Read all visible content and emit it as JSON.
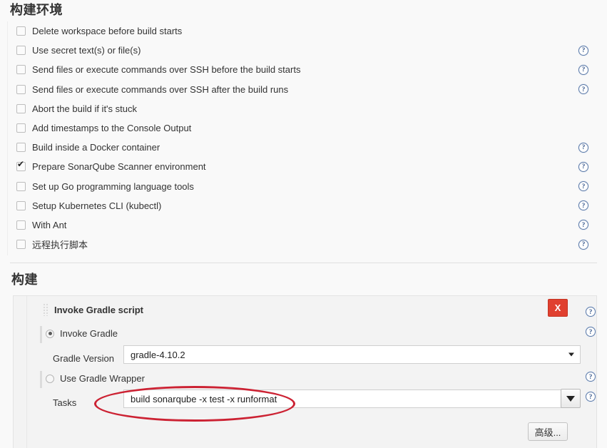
{
  "sections": {
    "build_environment_title": "构建环境",
    "build_title": "构建"
  },
  "build_environment": {
    "options": [
      {
        "label": "Delete workspace before build starts",
        "checked": false,
        "has_help": false
      },
      {
        "label": "Use secret text(s) or file(s)",
        "checked": false,
        "has_help": true
      },
      {
        "label": "Send files or execute commands over SSH before the build starts",
        "checked": false,
        "has_help": true
      },
      {
        "label": "Send files or execute commands over SSH after the build runs",
        "checked": false,
        "has_help": true
      },
      {
        "label": "Abort the build if it's stuck",
        "checked": false,
        "has_help": false
      },
      {
        "label": "Add timestamps to the Console Output",
        "checked": false,
        "has_help": false
      },
      {
        "label": "Build inside a Docker container",
        "checked": false,
        "has_help": true
      },
      {
        "label": "Prepare SonarQube Scanner environment",
        "checked": true,
        "has_help": true
      },
      {
        "label": "Set up Go programming language tools",
        "checked": false,
        "has_help": true
      },
      {
        "label": "Setup Kubernetes CLI (kubectl)",
        "checked": false,
        "has_help": true
      },
      {
        "label": "With Ant",
        "checked": false,
        "has_help": true
      },
      {
        "label": "远程执行脚本",
        "checked": false,
        "has_help": true
      }
    ]
  },
  "build_step": {
    "heading": "Invoke Gradle script",
    "close_label": "X",
    "radio_invoke_gradle": "Invoke Gradle",
    "radio_use_wrapper": "Use Gradle Wrapper",
    "gradle_version_label": "Gradle Version",
    "gradle_version_value": "gradle-4.10.2",
    "tasks_label": "Tasks",
    "tasks_value": "build sonarqube -x test -x runformat",
    "advanced_label": "高级...",
    "help_symbol": "?"
  },
  "colors": {
    "page_background": "#f9f9f9",
    "panel_background": "#f3f3f3",
    "close_button": "#e0402f",
    "annotation": "#cc2233",
    "help_icon": "#2d4f85"
  }
}
